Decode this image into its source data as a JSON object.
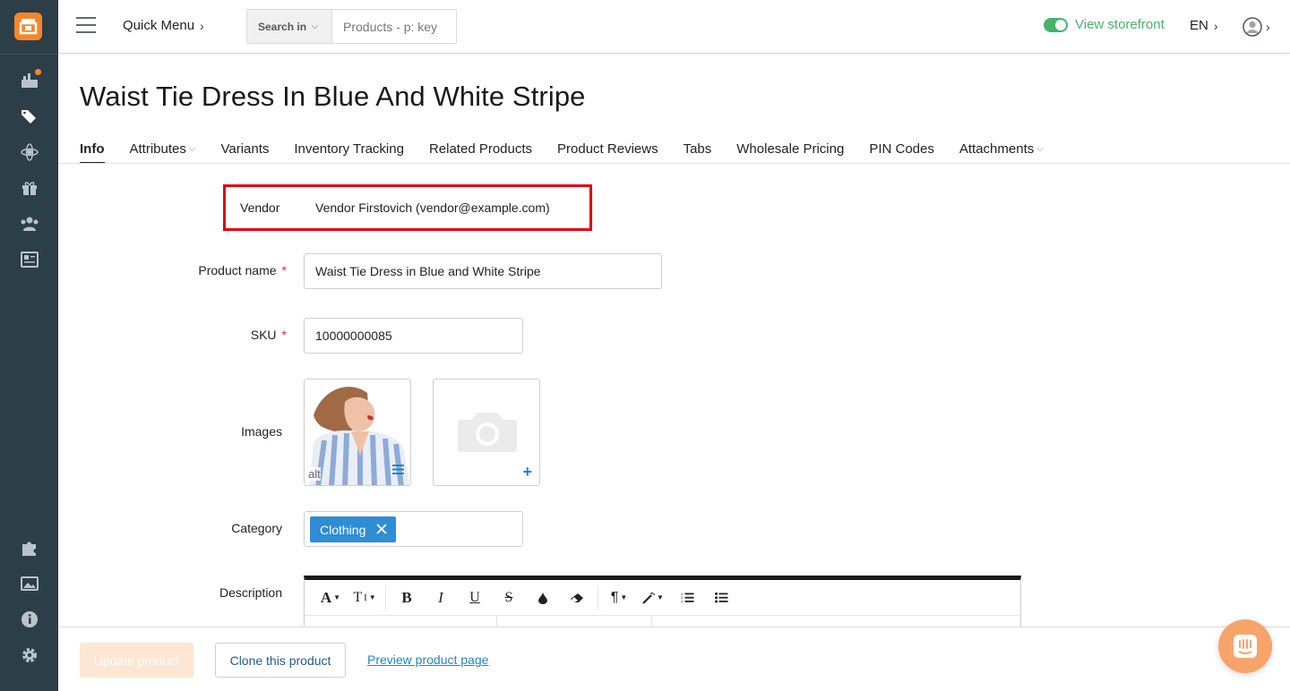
{
  "colors": {
    "sidebar_bg": "#2c3e47",
    "brand_orange": "#f7862b",
    "storefront_green": "#48b36b",
    "chip_blue": "#2f8dd3",
    "link_blue": "#1f86c8",
    "highlight_red": "#e2000f"
  },
  "sidebar": {
    "icons": [
      "logo-icon",
      "dashboard-icon",
      "tags-icon",
      "atom-icon",
      "gift-icon",
      "users-icon",
      "newspaper-icon",
      "puzzle-icon",
      "image-icon",
      "info-icon",
      "gear-icon"
    ]
  },
  "header": {
    "quick_menu": "Quick Menu",
    "search_in": "Search in",
    "search_placeholder": "Products - p: key",
    "view_storefront": "View storefront",
    "language": "EN"
  },
  "page": {
    "title": "Waist Tie Dress In Blue And White Stripe"
  },
  "tabs": [
    {
      "label": "Info",
      "active": true,
      "dropdown": false
    },
    {
      "label": "Attributes",
      "active": false,
      "dropdown": true
    },
    {
      "label": "Variants",
      "active": false,
      "dropdown": false
    },
    {
      "label": "Inventory Tracking",
      "active": false,
      "dropdown": false
    },
    {
      "label": "Related Products",
      "active": false,
      "dropdown": false
    },
    {
      "label": "Product Reviews",
      "active": false,
      "dropdown": false
    },
    {
      "label": "Tabs",
      "active": false,
      "dropdown": false
    },
    {
      "label": "Wholesale Pricing",
      "active": false,
      "dropdown": false
    },
    {
      "label": "PIN Codes",
      "active": false,
      "dropdown": false
    },
    {
      "label": "Attachments",
      "active": false,
      "dropdown": true
    }
  ],
  "form": {
    "vendor_label": "Vendor",
    "vendor_value": "Vendor Firstovich (vendor@example.com)",
    "product_name_label": "Product name",
    "product_name_value": "Waist Tie Dress in Blue and White Stripe",
    "sku_label": "SKU",
    "sku_value": "10000000085",
    "required_mark": "*",
    "images_label": "Images",
    "image_alt": "alt",
    "add_image": "+",
    "category_label": "Category",
    "category_chip": "Clothing",
    "description_label": "Description"
  },
  "editor_toolbar": [
    "font-icon",
    "text-size-icon",
    "bold-icon",
    "italic-icon",
    "underline-icon",
    "strikethrough-icon",
    "color-drop-icon",
    "eraser-icon",
    "paragraph-icon",
    "magic-wand-icon",
    "ordered-list-icon",
    "unordered-list-icon"
  ],
  "footer": {
    "update_button": "Update product",
    "clone_button": "Clone this product",
    "preview_link": "Preview product page"
  }
}
